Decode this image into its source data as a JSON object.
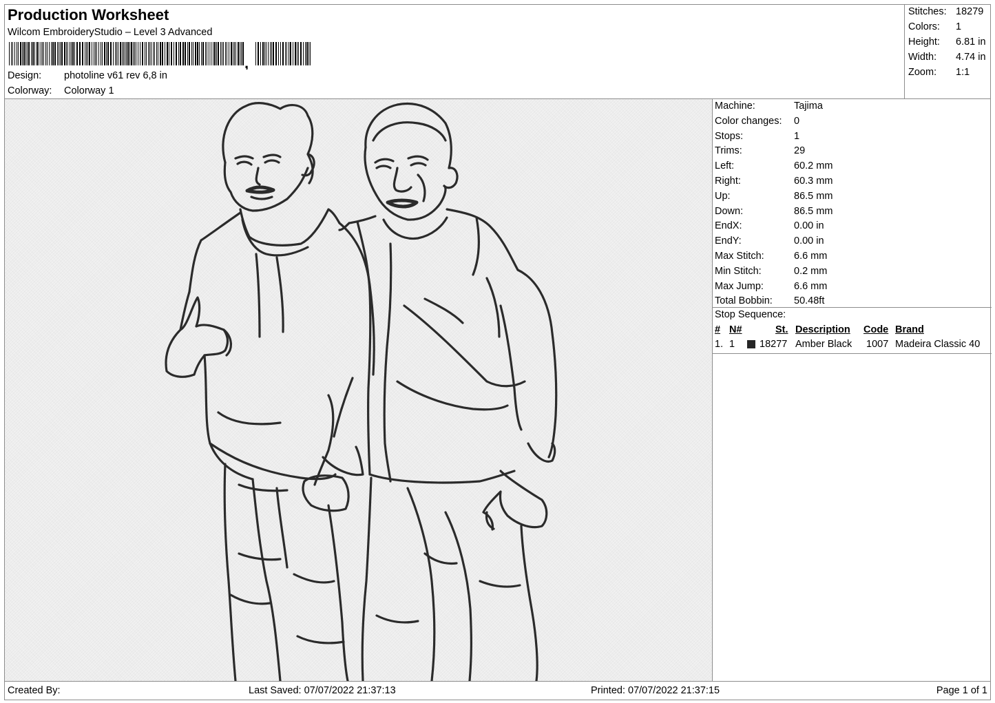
{
  "header": {
    "title": "Production Worksheet",
    "software": "Wilcom EmbroideryStudio – Level 3 Advanced",
    "design_label": "Design:",
    "design_value": "photoline v61 rev 6,8 in",
    "colorway_label": "Colorway:",
    "colorway_value": "Colorway 1"
  },
  "summary": {
    "stitches_label": "Stitches:",
    "stitches_value": "18279",
    "colors_label": "Colors:",
    "colors_value": "1",
    "height_label": "Height:",
    "height_value": "6.81 in",
    "width_label": "Width:",
    "width_value": "4.74 in",
    "zoom_label": "Zoom:",
    "zoom_value": "1:1"
  },
  "details": {
    "rows": [
      {
        "label": "Machine:",
        "value": "Tajima"
      },
      {
        "label": "Color changes:",
        "value": "0"
      },
      {
        "label": "Stops:",
        "value": "1"
      },
      {
        "label": "Trims:",
        "value": "29"
      },
      {
        "label": "Left:",
        "value": "60.2 mm"
      },
      {
        "label": "Right:",
        "value": "60.3 mm"
      },
      {
        "label": "Up:",
        "value": "86.5 mm"
      },
      {
        "label": "Down:",
        "value": "86.5 mm"
      },
      {
        "label": "EndX:",
        "value": "0.00 in"
      },
      {
        "label": "EndY:",
        "value": "0.00 in"
      },
      {
        "label": "Max Stitch:",
        "value": "6.6 mm"
      },
      {
        "label": "Min Stitch:",
        "value": "0.2 mm"
      },
      {
        "label": "Max Jump:",
        "value": "6.6 mm"
      },
      {
        "label": "Total Bobbin:",
        "value": "50.48ft"
      }
    ]
  },
  "stop_sequence": {
    "title": "Stop Sequence:",
    "headers": {
      "num": "#",
      "needle": "N#",
      "stitches": "St.",
      "description": "Description",
      "code": "Code",
      "brand": "Brand"
    },
    "rows": [
      {
        "num": "1.",
        "needle": "1",
        "color": "#262626",
        "stitches": "18277",
        "description": "Amber Black",
        "code": "1007",
        "brand": "Madeira Classic 40"
      }
    ]
  },
  "footer": {
    "created_by": "Created By:",
    "last_saved": "Last Saved: 07/07/2022 21:37:13",
    "printed": "Printed: 07/07/2022 21:37:15",
    "page": "Page 1 of 1"
  },
  "design": {
    "thread_color": "#2b2b2b",
    "background_color": "#ececec"
  }
}
